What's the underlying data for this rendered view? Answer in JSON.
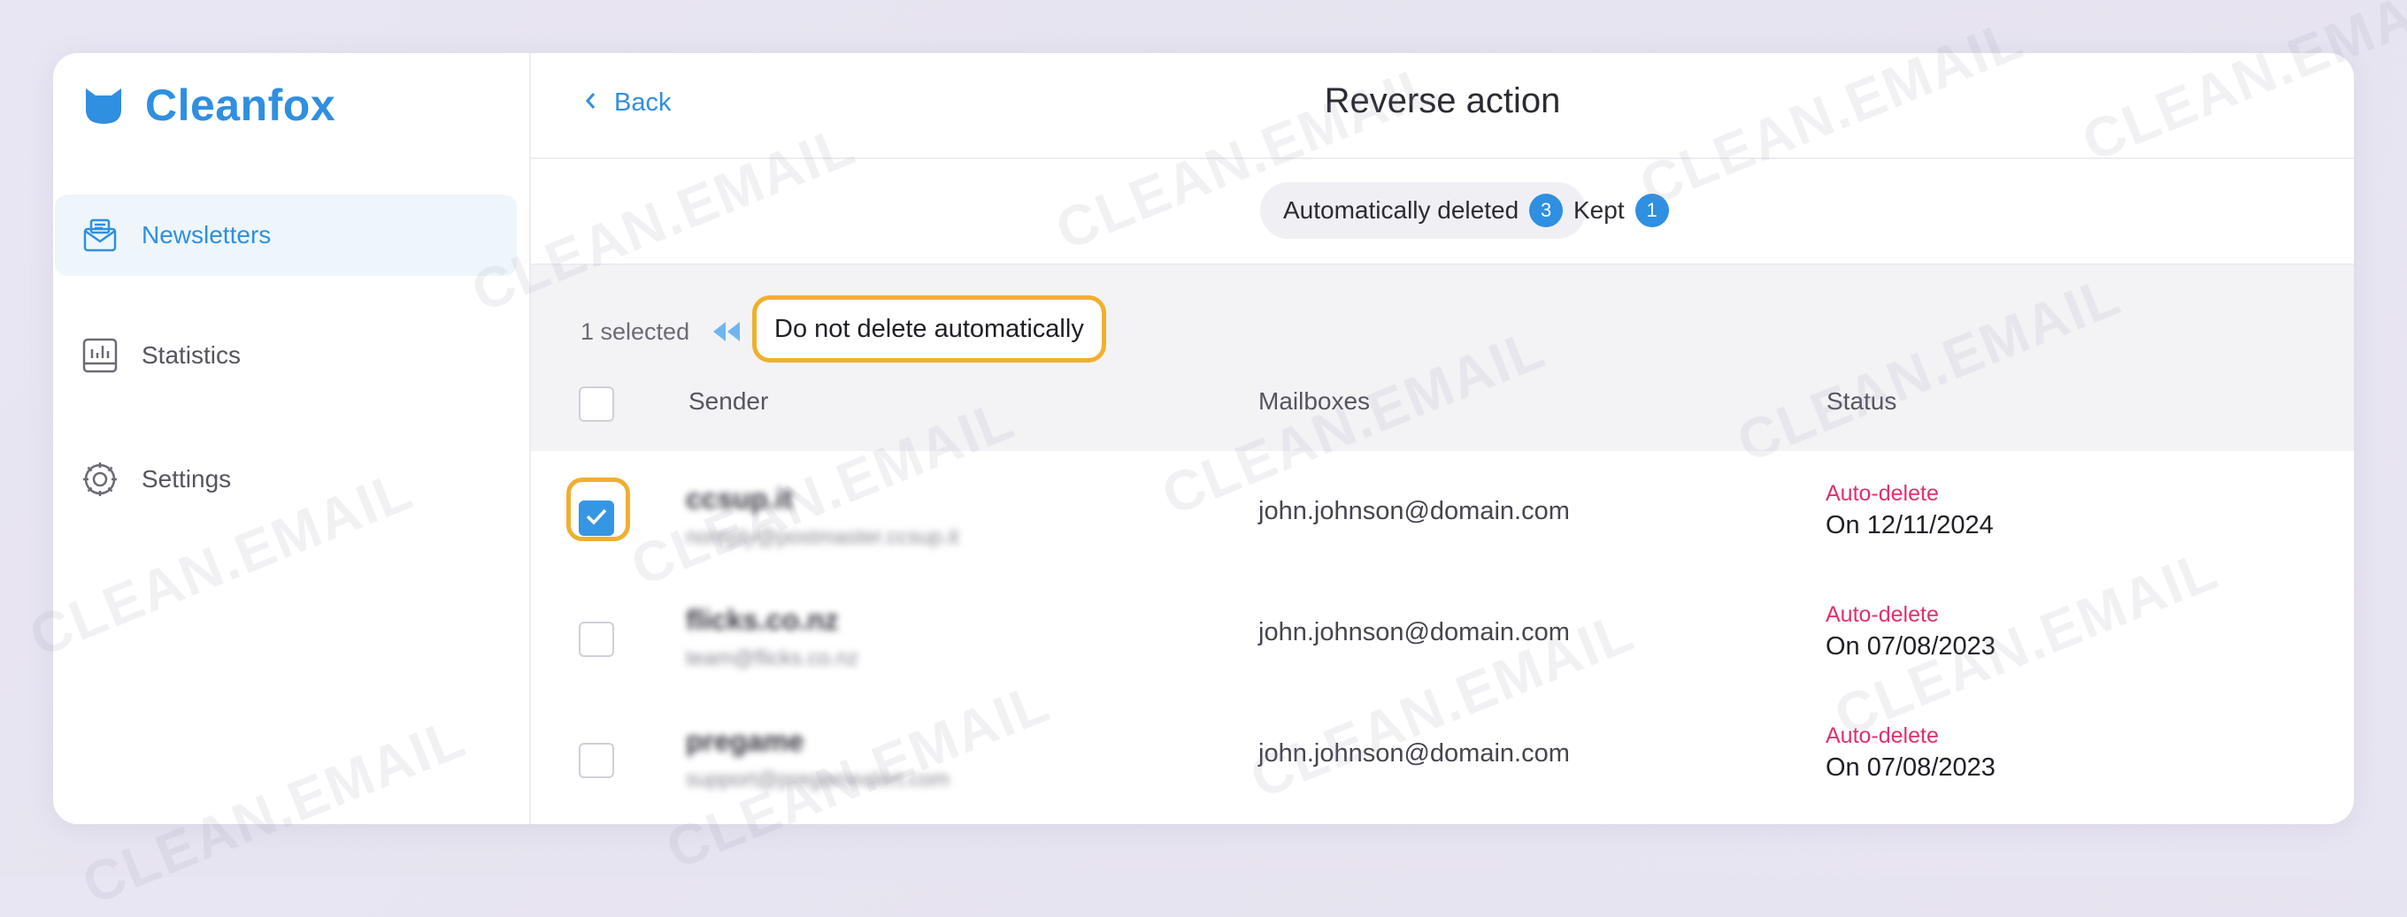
{
  "app": {
    "name": "Cleanfox"
  },
  "sidebar": {
    "items": [
      {
        "label": "Newsletters",
        "icon": "newsletter-icon",
        "active": true
      },
      {
        "label": "Statistics",
        "icon": "statistics-icon",
        "active": false
      },
      {
        "label": "Settings",
        "icon": "gear-icon",
        "active": false
      }
    ]
  },
  "header": {
    "back_label": "Back",
    "title": "Reverse action"
  },
  "tabs": [
    {
      "label": "Automatically deleted",
      "count": "3",
      "active": true
    },
    {
      "label": "Kept",
      "count": "1",
      "active": false
    }
  ],
  "selection": {
    "count_label": "1 selected",
    "action_label": "Do not delete automatically"
  },
  "table": {
    "columns": {
      "sender": "Sender",
      "mailboxes": "Mailboxes",
      "status": "Status"
    },
    "rows": [
      {
        "sender_name": "ccsup.it",
        "sender_email": "noreply@postmaster.ccsup.it",
        "mailbox": "john.johnson@domain.com",
        "status_label": "Auto-delete",
        "status_date": "On 12/11/2024",
        "checked": true
      },
      {
        "sender_name": "flicks.co.nz",
        "sender_email": "team@flicks.co.nz",
        "mailbox": "john.johnson@domain.com",
        "status_label": "Auto-delete",
        "status_date": "On 07/08/2023",
        "checked": false
      },
      {
        "sender_name": "pregame",
        "sender_email": "support@pregamealert.com",
        "mailbox": "john.johnson@domain.com",
        "status_label": "Auto-delete",
        "status_date": "On 07/08/2023",
        "checked": false
      }
    ]
  },
  "watermark": "CLEAN.EMAIL",
  "colors": {
    "accent": "#2f8fe0",
    "highlight": "#f0b02e",
    "status": "#e2306c"
  }
}
